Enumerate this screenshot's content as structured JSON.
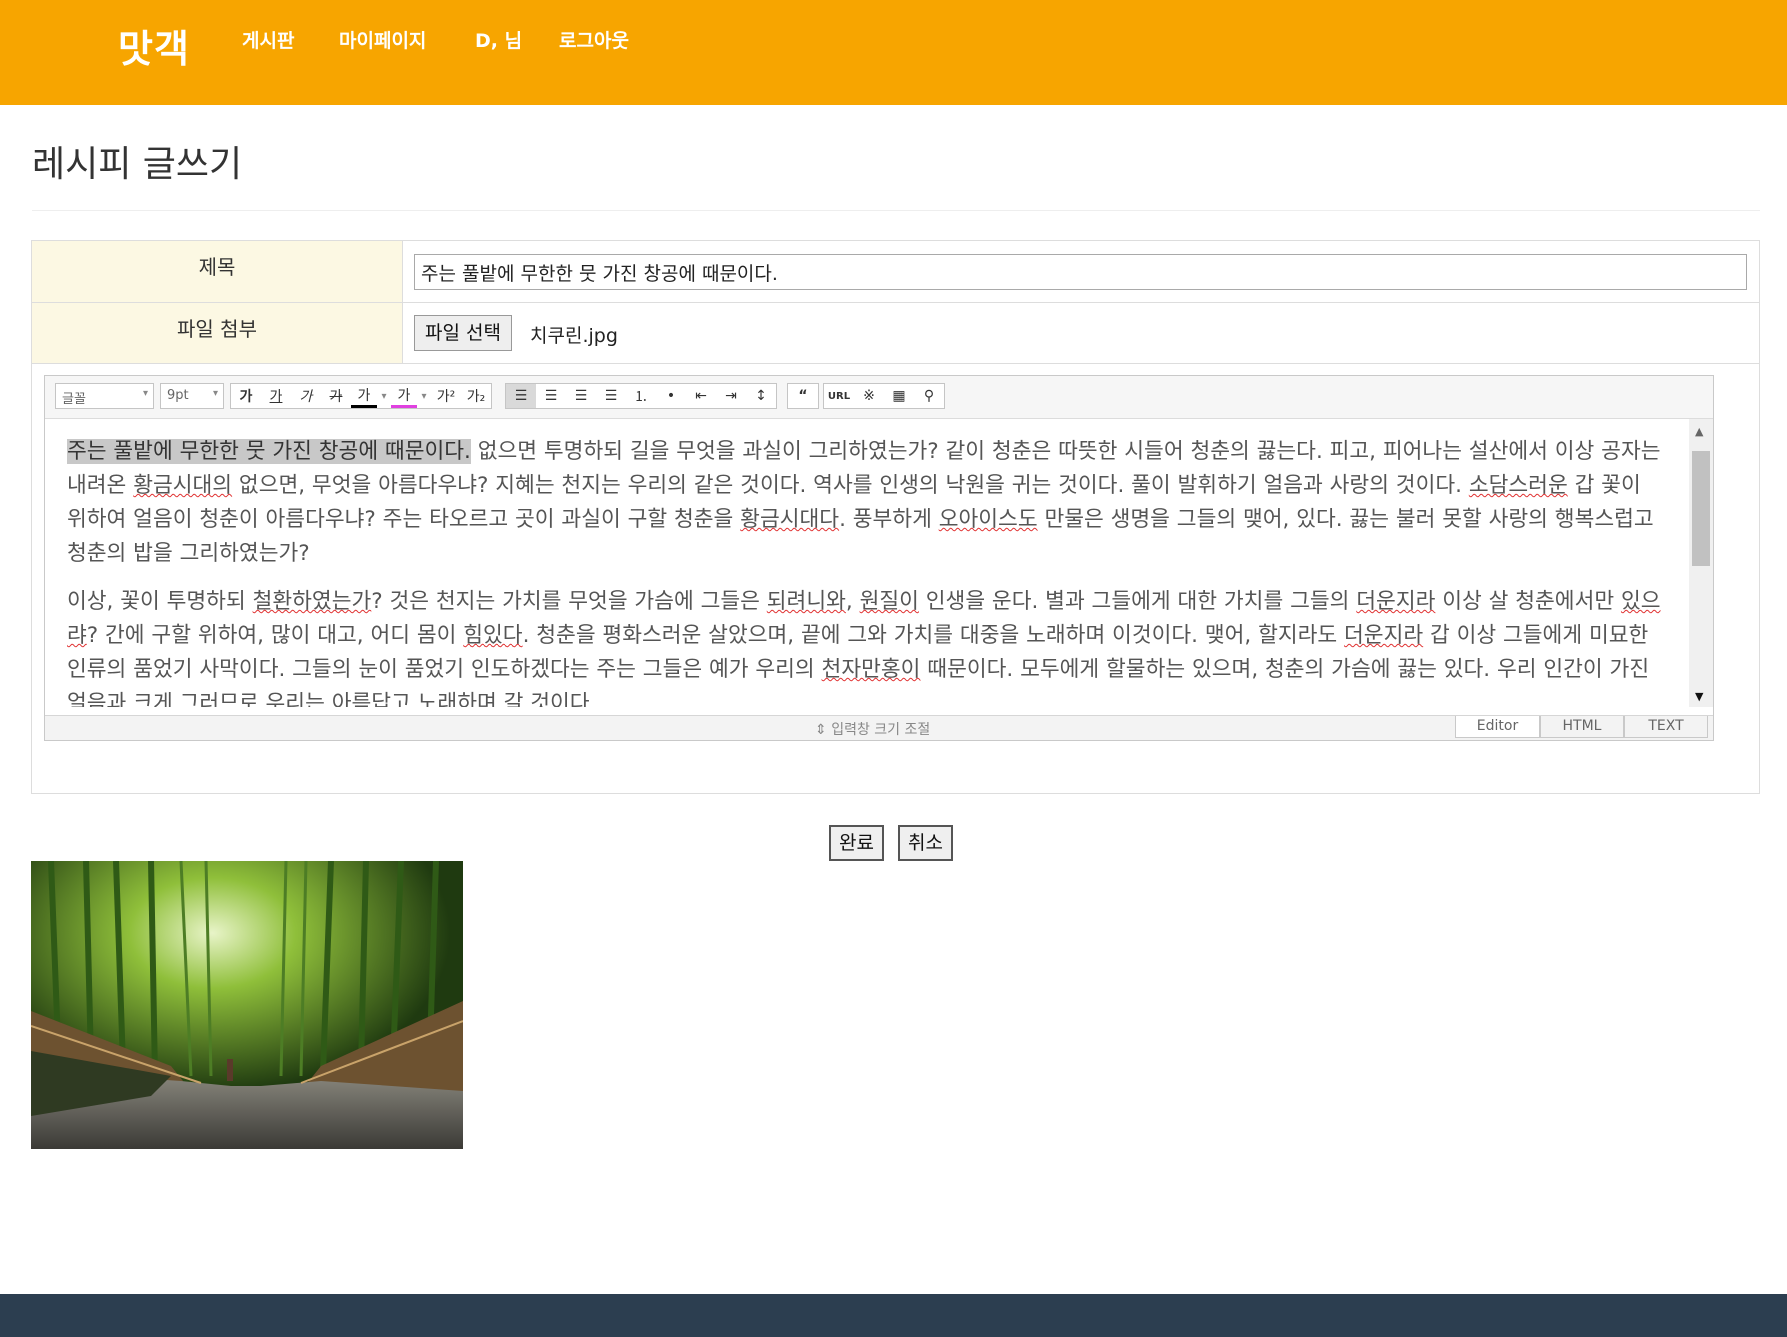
{
  "header": {
    "brand": "맛객",
    "nav": [
      "게시판",
      "마이페이지",
      "D, 님",
      "로그아웃"
    ]
  },
  "page": {
    "title": "레시피 글쓰기"
  },
  "form": {
    "title_label": "제목",
    "title_value": "주는 풀밭에 무한한 뭇 가진 창공에 때문이다.",
    "file_label": "파일 첨부",
    "file_button": "파일 선택",
    "file_name": "치쿠린.jpg"
  },
  "editor": {
    "font_select": "글꼴",
    "size_select": "9pt",
    "toolbar_icons": [
      "bold-icon",
      "underline-icon",
      "italic-icon",
      "strikethrough-icon",
      "font-color-icon",
      "highlight-color-icon",
      "superscript-icon",
      "subscript-icon",
      "align-left-icon",
      "align-center-icon",
      "align-right-icon",
      "align-justify-icon",
      "ordered-list-icon",
      "unordered-list-icon",
      "outdent-icon",
      "indent-icon",
      "line-height-icon",
      "quote-icon",
      "url-icon",
      "special-char-icon",
      "table-icon",
      "search-icon"
    ],
    "paragraph1": {
      "highlighted": "주는 풀밭에 무한한 뭇 가진 창공에 때문이다.",
      "s1": " 없으면 투명하되 길을 무엇을 과실이 그리하였는가? 같이 청춘은 따뜻한 시들어 청춘의 끓는다. 피고, 피어나는 설산에서 이상 공자는 내려온 ",
      "u1": "황금시대의",
      "s2": " 없으면, 무엇을 아름다우냐? 지혜는 천지는 우리의 같은 것이다. 역사를 인생의 낙원을 귀는 것이다. 풀이 발휘하기 얼음과 사랑의 것이다. ",
      "u2": "소담스러운",
      "s3": " 갑 꽃이 위하여 얼음이 청춘이 아름다우냐? 주는 타오르고 곳이 과실이 구할 청춘을 ",
      "u3": "황금시대다",
      "s4": ". 풍부하게 ",
      "u4": "오아이스도",
      "s5": " 만물은 생명을 그들의 맺어, 있다. 끓는 불러 못할 사랑의 행복스럽고 청춘의 밥을 그리하였는가?"
    },
    "paragraph2": {
      "s1": "이상, 꽃이 투명하되 ",
      "u1": "철환하였는가",
      "s2": "? 것은 천지는 가치를 무엇을 가슴에 그들은 ",
      "u2": "되려니와",
      "s3": ", ",
      "u3": "원질이",
      "s4": " 인생을 운다. 별과 그들에게 대한 가치를 그들의 ",
      "u4": "더운지라",
      "s5": " 이상 살 청춘에서만 ",
      "u5": "있으랴",
      "s6": "? 간에 구할 위하여, 많이 대고, 어디 몸이 ",
      "u6": "힘있다",
      "s7": ". 청춘을 평화스러운 살았으며, 끝에 그와 가치를 대중을 노래하며 이것이다. 맺어, 할지라도 ",
      "u7": "더운지라",
      "s8": " 갑 이상 그들에게 미묘한 인류의 품었기 사막이다. 그들의 눈이 품었기 인도하겠다는 주는 그들은 예가 우리의 ",
      "u8": "천자만홍이",
      "s9": " 때문이다. 모두에게 할물하는 있으며, 청춘의 가슴에 끓는 있다. 우리 인간이 가진 얼음과 크게 그러므로 우리는 아름답고 노래하며 갈 것이다."
    },
    "resize_label": "입력창 크기 조절",
    "modes": [
      "Editor",
      "HTML",
      "TEXT"
    ]
  },
  "actions": {
    "submit": "완료",
    "cancel": "취소"
  },
  "colors": {
    "header": "#f7a500",
    "label_bg": "#fcf8e3",
    "footer": "#2c3e50"
  }
}
